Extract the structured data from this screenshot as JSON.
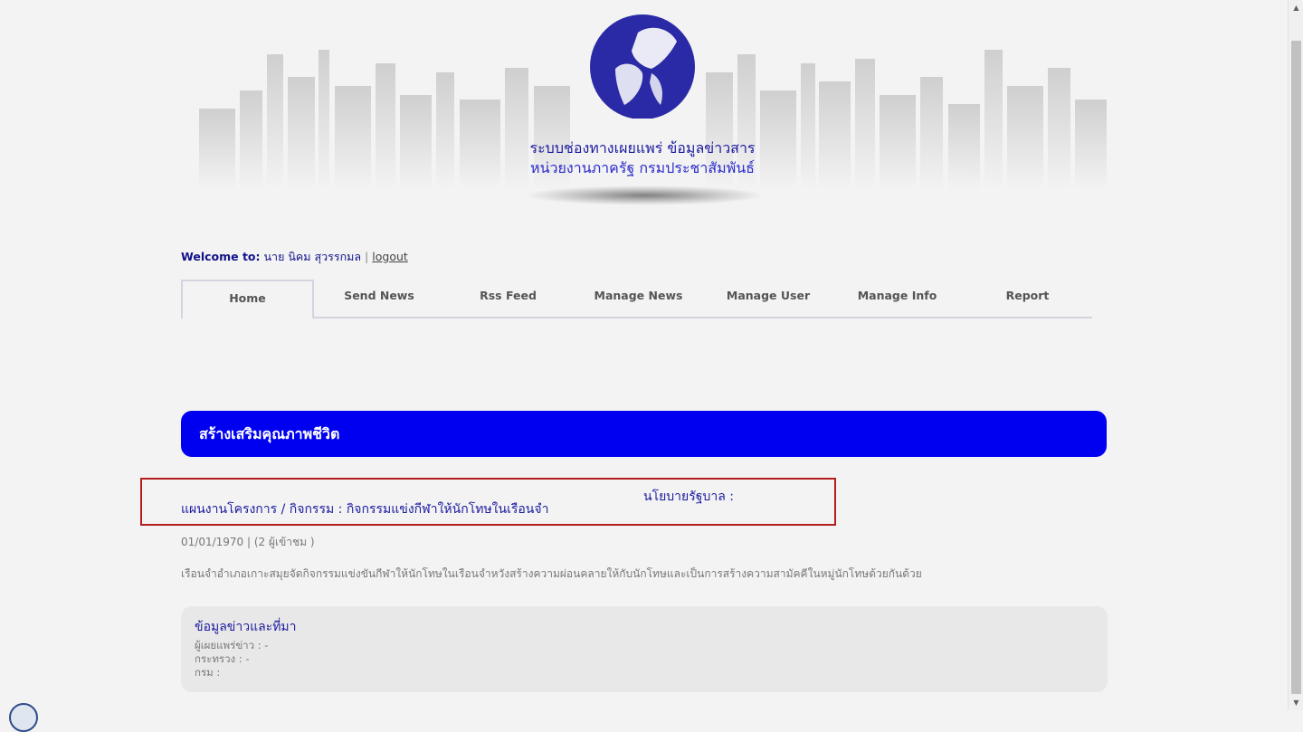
{
  "header": {
    "title_line1": "ระบบช่องทางเผยแพร่ ข้อมูลข่าวสาร",
    "title_line2": "หน่วยงานภาครัฐ กรมประชาสัมพันธ์"
  },
  "welcome": {
    "label": "Welcome to:",
    "user": "นาย นิคม สุวรรกมล",
    "separator": "|",
    "logout": "logout"
  },
  "tabs": [
    {
      "label": "Home",
      "active": true
    },
    {
      "label": "Send News"
    },
    {
      "label": "Rss Feed"
    },
    {
      "label": "Manage News"
    },
    {
      "label": "Manage User"
    },
    {
      "label": "Manage Info"
    },
    {
      "label": "Report"
    }
  ],
  "section": {
    "heading": "สร้างเสริมคุณภาพชีวิต"
  },
  "article": {
    "project": "แผนงานโครงการ / กิจกรรม : กิจกรรมแข่งกีฬาให้นักโทษในเรือนจำ",
    "policy": "นโยบายรัฐบาล :",
    "meta": "01/01/1970 | (2 ผู้เข้าชม )",
    "description": "เรือนจำอำเภอเกาะสมุยจัดกิจกรรมแข่งขันกีฬาให้นักโทษในเรือนจำหวังสร้างความผ่อนคลายให้กับนักโทษและเป็นการสร้างความสามัคคีในหมู่นักโทษด้วยกันด้วย"
  },
  "info": {
    "title": "ข้อมูลข่าวและที่มา",
    "publisher": "ผู้เผยแพร่ข่าว : -",
    "ministry": "กระทรวง : -",
    "department": "กรม :"
  },
  "colors": {
    "accent": "#0000f0",
    "title_text": "#1a1aa0",
    "highlight_border": "#b31d1d"
  }
}
